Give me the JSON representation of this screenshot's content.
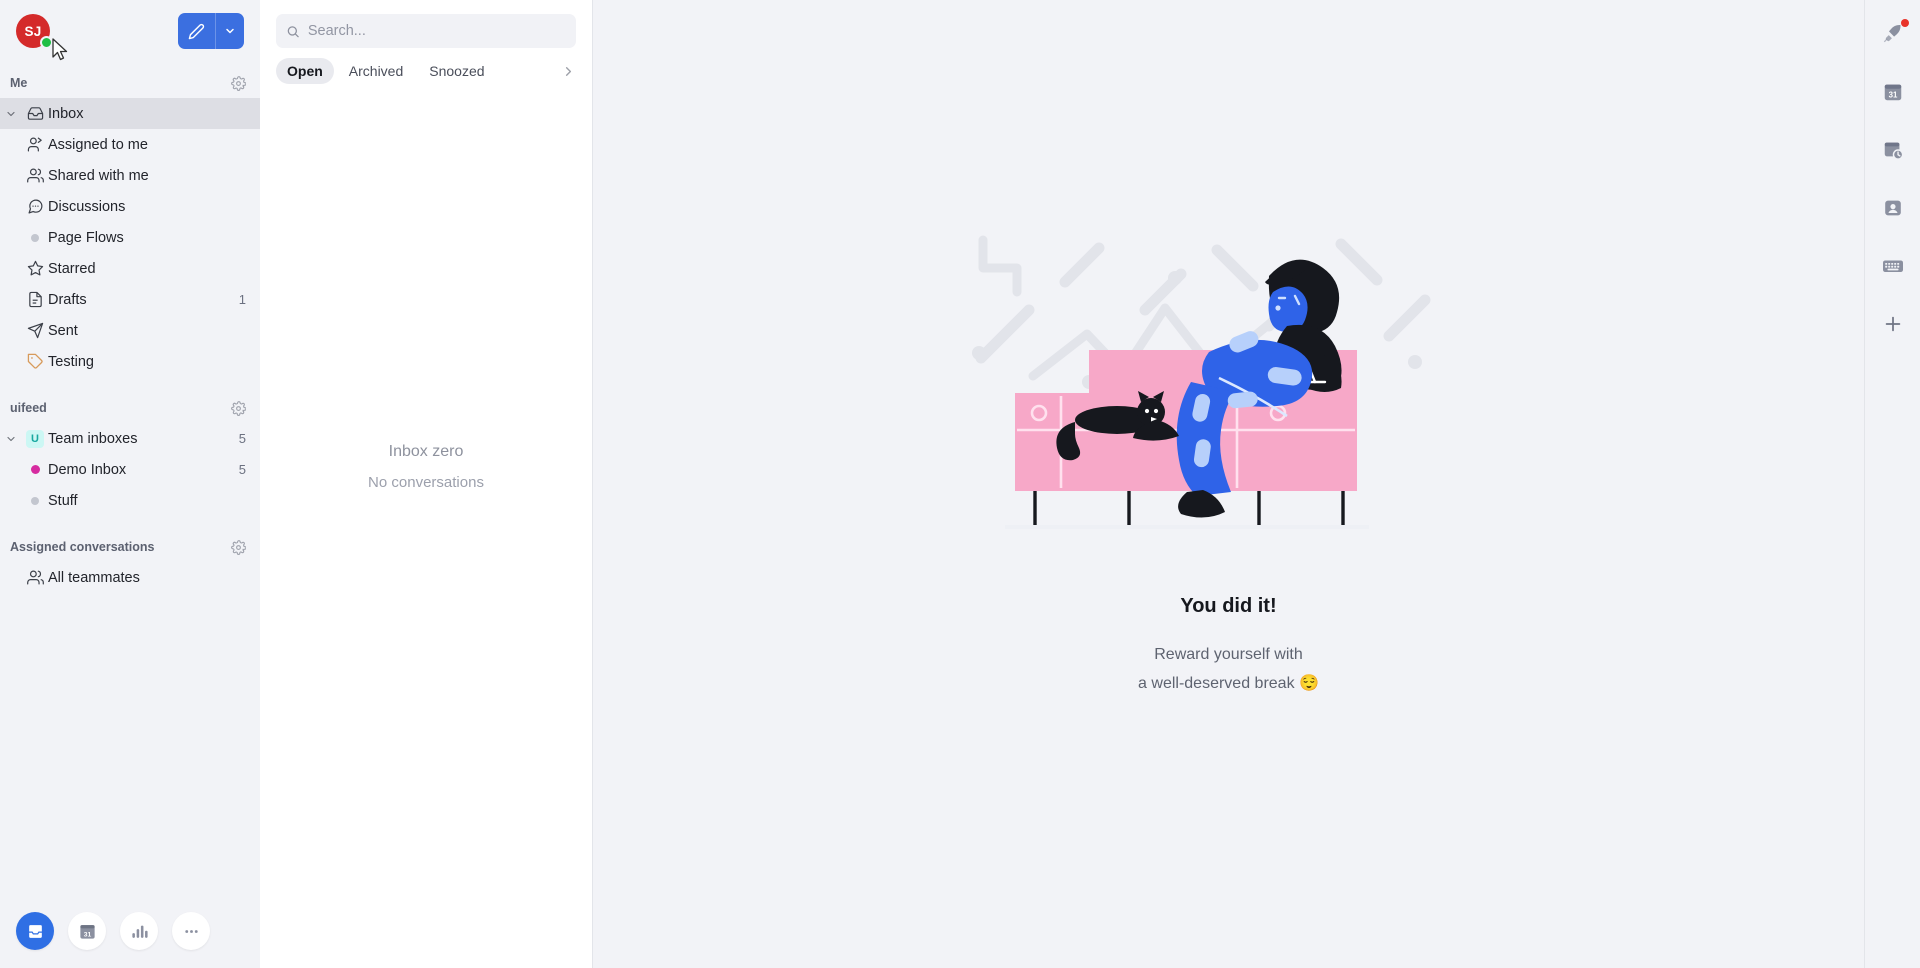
{
  "sidebar": {
    "avatar": {
      "initials": "SJ",
      "bg_color": "#d42a2a",
      "status_color": "#20bf45",
      "status": "online"
    },
    "compose": {
      "label": "compose",
      "icon": "pencil-icon",
      "caret_icon": "chevron-down-icon",
      "color": "#3b6fe0"
    },
    "sections": [
      {
        "title": "Me",
        "settings_icon": "gear-icon",
        "items": [
          {
            "label": "Inbox",
            "icon": "inbox-icon",
            "indent": 0,
            "count": "",
            "active": true,
            "expandable": true
          },
          {
            "label": "Assigned to me",
            "icon": "assigned-person-icon",
            "indent": 1,
            "count": ""
          },
          {
            "label": "Shared with me",
            "icon": "people-icon",
            "indent": 1,
            "count": ""
          },
          {
            "label": "Discussions",
            "icon": "chat-bubble-icon",
            "indent": 1,
            "count": ""
          },
          {
            "label": "Page Flows",
            "icon": "dot-icon",
            "indent": 1,
            "count": ""
          },
          {
            "label": "Starred",
            "icon": "star-icon",
            "indent": 0,
            "count": ""
          },
          {
            "label": "Drafts",
            "icon": "document-icon",
            "indent": 0,
            "count": "1"
          },
          {
            "label": "Sent",
            "icon": "paper-plane-icon",
            "indent": 0,
            "count": ""
          },
          {
            "label": "Testing",
            "icon": "tag-icon",
            "indent": 0,
            "count": "",
            "icon_color": "#d79a5b"
          }
        ]
      },
      {
        "title": "uifeed",
        "settings_icon": "gear-icon",
        "items": [
          {
            "label": "Team inboxes",
            "icon": "team-badge-U",
            "indent": 0,
            "count": "5",
            "expandable": true
          },
          {
            "label": "Demo Inbox",
            "icon": "pink-dot-icon",
            "indent": 1,
            "count": "5"
          },
          {
            "label": "Stuff",
            "icon": "dot-icon",
            "indent": 1,
            "count": ""
          }
        ]
      },
      {
        "title": "Assigned conversations",
        "settings_icon": "gear-icon",
        "items": [
          {
            "label": "All teammates",
            "icon": "people-icon",
            "indent": 0,
            "count": ""
          }
        ]
      }
    ],
    "bottom_nav": [
      {
        "name": "inbox",
        "icon": "inbox-icon",
        "active": true
      },
      {
        "name": "calendar",
        "icon": "calendar-31-icon",
        "active": false
      },
      {
        "name": "analytics",
        "icon": "bar-chart-icon",
        "active": false
      },
      {
        "name": "more",
        "icon": "ellipsis-icon",
        "active": false
      }
    ]
  },
  "list_pane": {
    "search": {
      "placeholder": "Search...",
      "value": "",
      "icon": "search-icon"
    },
    "tabs": [
      {
        "label": "Open",
        "active": true
      },
      {
        "label": "Archived",
        "active": false
      },
      {
        "label": "Snoozed",
        "active": false
      }
    ],
    "tabs_more_icon": "chevron-right-icon",
    "empty": {
      "title": "Inbox zero",
      "subtitle": "No conversations"
    }
  },
  "main": {
    "illustration": "person-relaxing-on-couch-with-cat",
    "title": "You did it!",
    "subtitle_line1": "Reward yourself with",
    "subtitle_line2": "a well-deserved break 😌"
  },
  "rail": {
    "items": [
      {
        "name": "rocket",
        "icon": "rocket-icon",
        "badge": true
      },
      {
        "name": "calendar",
        "icon": "calendar-31-icon",
        "badge": false
      },
      {
        "name": "snooze",
        "icon": "calendar-clock-icon",
        "badge": false
      },
      {
        "name": "contacts",
        "icon": "contact-card-icon",
        "badge": false
      },
      {
        "name": "shortcuts",
        "icon": "keyboard-icon",
        "badge": false
      },
      {
        "name": "add",
        "icon": "plus-icon",
        "badge": false
      }
    ]
  }
}
